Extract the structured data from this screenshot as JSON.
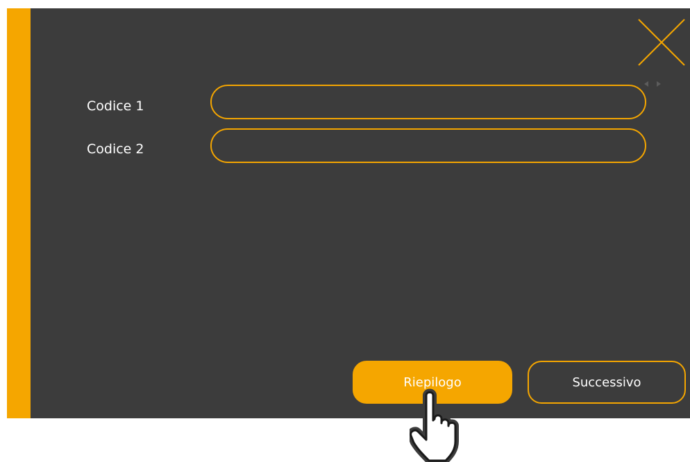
{
  "form": {
    "fields": [
      {
        "label": "Codice 1",
        "value": "",
        "placeholder": ""
      },
      {
        "label": "Codice 2",
        "value": "",
        "placeholder": ""
      }
    ]
  },
  "buttons": {
    "summary_label": "Riepilogo",
    "next_label": "Successivo"
  },
  "icons": {
    "close": "close-icon",
    "scroll_left": "arrow-left-icon",
    "scroll_right": "arrow-right-icon",
    "cursor": "hand-pointer-icon"
  },
  "colors": {
    "accent": "#f5a600",
    "panel_background": "#3c3c3c",
    "text": "#ffffff"
  }
}
